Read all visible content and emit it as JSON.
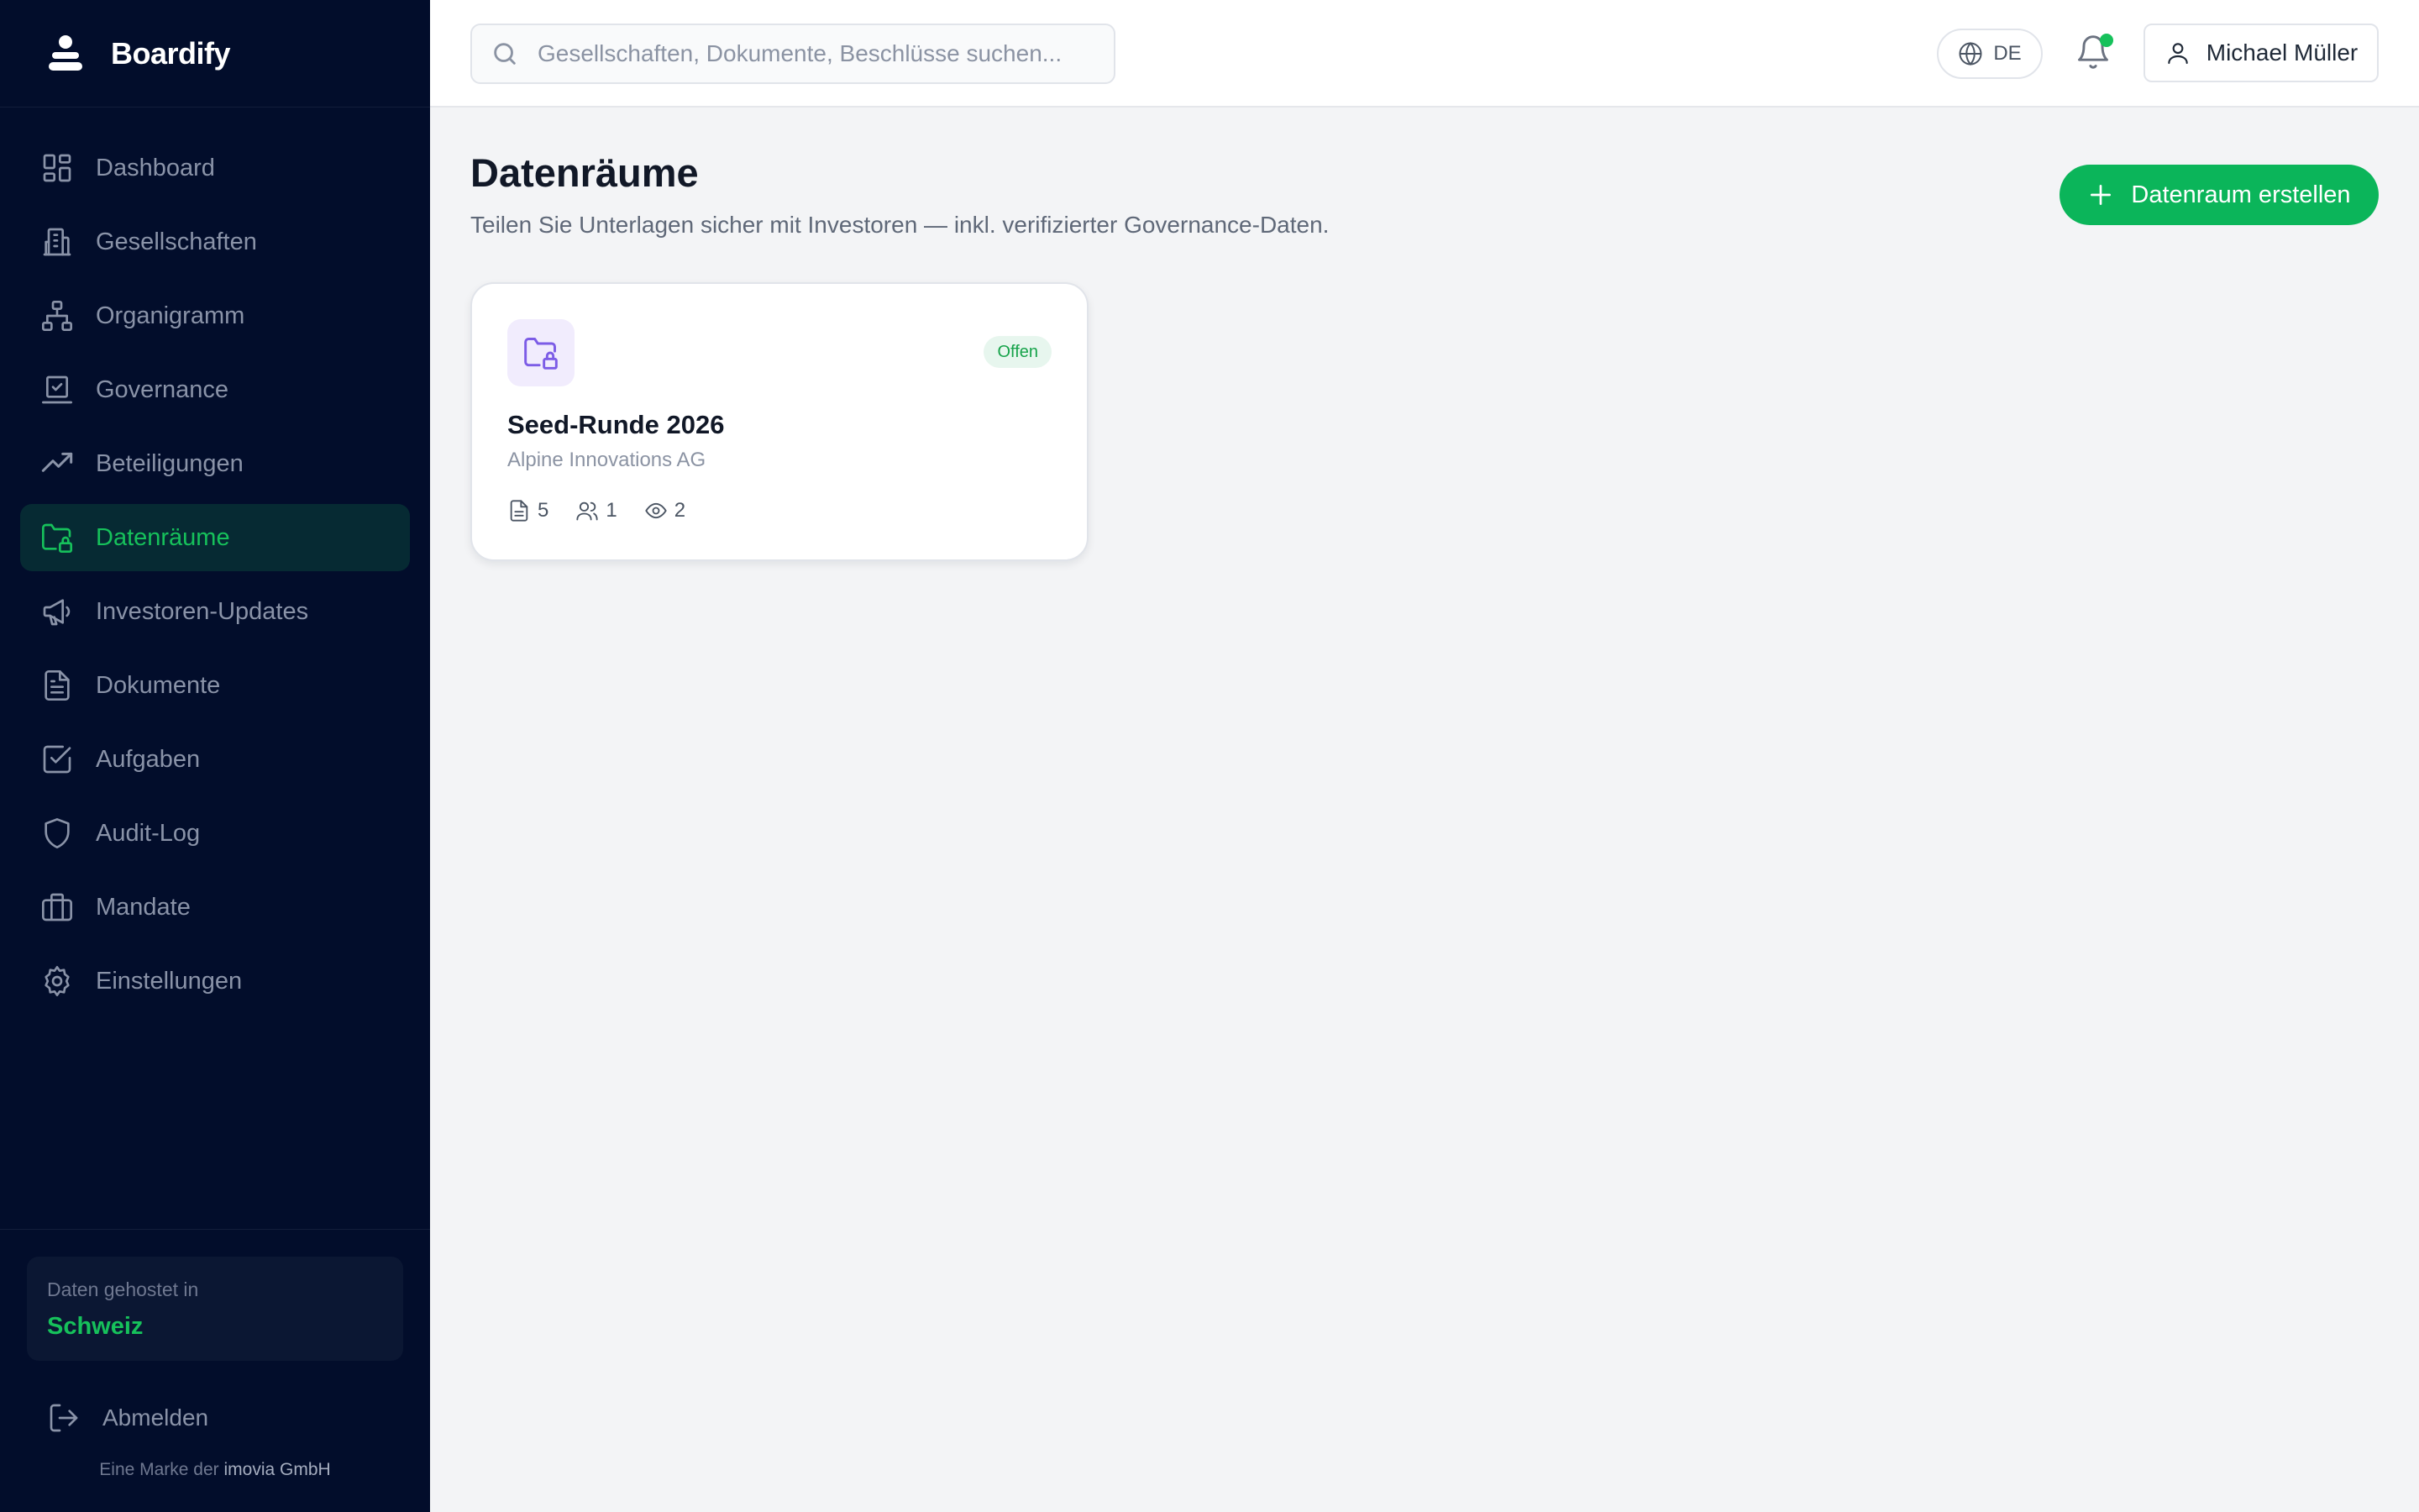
{
  "app": {
    "name": "Boardify"
  },
  "sidebar": {
    "items": [
      {
        "label": "Dashboard",
        "icon": "dashboard-icon",
        "active": false
      },
      {
        "label": "Gesellschaften",
        "icon": "building-icon",
        "active": false
      },
      {
        "label": "Organigramm",
        "icon": "org-chart-icon",
        "active": false
      },
      {
        "label": "Governance",
        "icon": "governance-icon",
        "active": false
      },
      {
        "label": "Beteiligungen",
        "icon": "trending-up-icon",
        "active": false
      },
      {
        "label": "Datenräume",
        "icon": "folder-lock-icon",
        "active": true
      },
      {
        "label": "Investoren-Updates",
        "icon": "megaphone-icon",
        "active": false
      },
      {
        "label": "Dokumente",
        "icon": "file-text-icon",
        "active": false
      },
      {
        "label": "Aufgaben",
        "icon": "check-square-icon",
        "active": false
      },
      {
        "label": "Audit-Log",
        "icon": "shield-icon",
        "active": false
      },
      {
        "label": "Mandate",
        "icon": "briefcase-icon",
        "active": false
      },
      {
        "label": "Einstellungen",
        "icon": "gear-icon",
        "active": false
      }
    ],
    "hosting": {
      "label": "Daten gehostet in",
      "country": "Schweiz"
    },
    "logout_label": "Abmelden",
    "footer": {
      "prefix": "Eine Marke der",
      "company": "imovia GmbH"
    }
  },
  "topbar": {
    "search_placeholder": "Gesellschaften, Dokumente, Beschlüsse suchen...",
    "language": "DE",
    "notifications_unread": true,
    "user_name": "Michael Müller"
  },
  "main": {
    "title": "Datenräume",
    "subtitle": "Teilen Sie Unterlagen sicher mit Investoren — inkl. verifizierter Governance-Daten.",
    "create_button_label": "Datenraum erstellen",
    "rooms": [
      {
        "title": "Seed-Runde 2026",
        "company": "Alpine Innovations AG",
        "status": "Offen",
        "documents": "5",
        "members": "1",
        "views": "2"
      }
    ]
  },
  "colors": {
    "sidebar_bg": "#020d2b",
    "accent_green": "#16c15b",
    "button_green": "#0bb55a",
    "room_icon_purple": "#7c5ce6"
  }
}
